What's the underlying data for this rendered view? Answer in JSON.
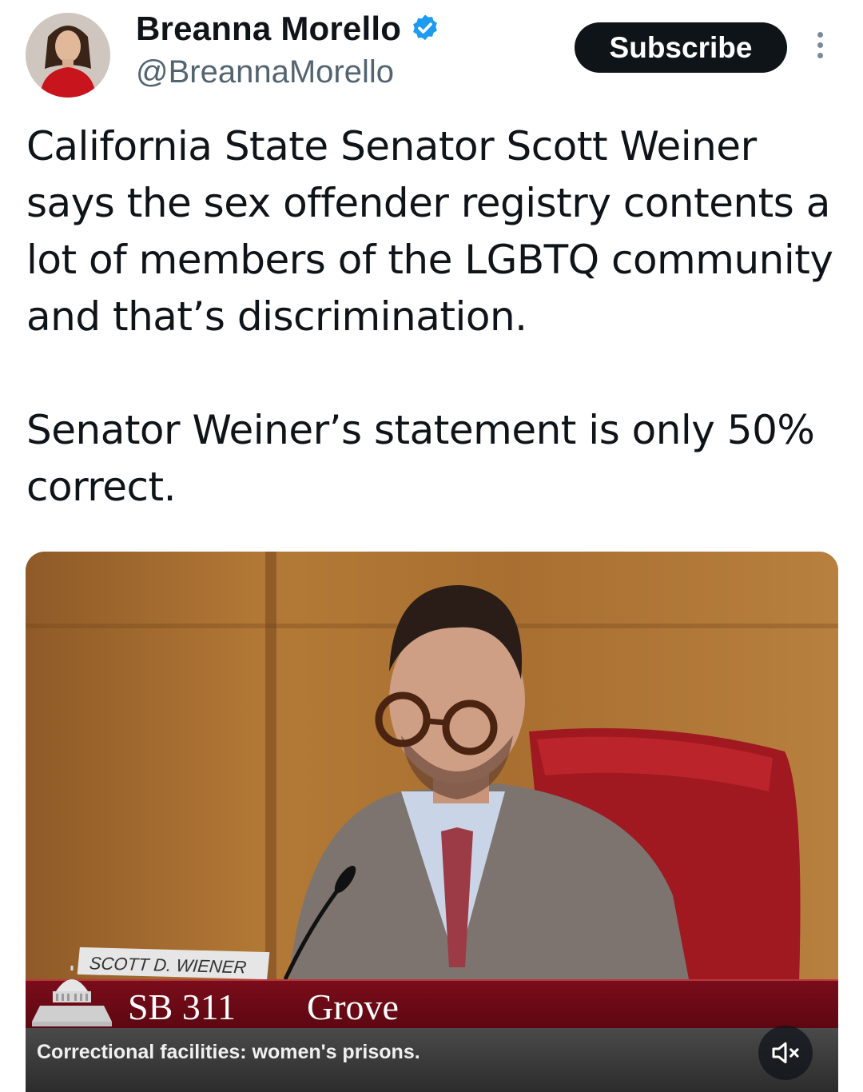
{
  "author": {
    "name": "Breanna Morello",
    "handle": "@BreannaMorello",
    "verified": true,
    "avatar_icon": "avatar-photo"
  },
  "actions": {
    "subscribe_label": "Subscribe",
    "more_icon": "vertical-ellipsis-icon"
  },
  "tweet": {
    "paragraphs": [
      "California State Senator Scott Weiner says the sex offender registry contents a lot of members of the LGBTQ community and that’s discrimination.",
      "Senator Weiner’s statement is only 50% correct."
    ]
  },
  "media": {
    "nameplate": "SCOTT D. WIENER",
    "bill_number": "SB 311",
    "bill_author": "Grove",
    "caption": "Correctional facilities: women's prisons.",
    "mute_icon": "muted-speaker-icon"
  },
  "colors": {
    "accent_blue": "#1d9bf0",
    "subscribe_bg": "#0f1419",
    "lower_third": "#7a0d1a"
  }
}
